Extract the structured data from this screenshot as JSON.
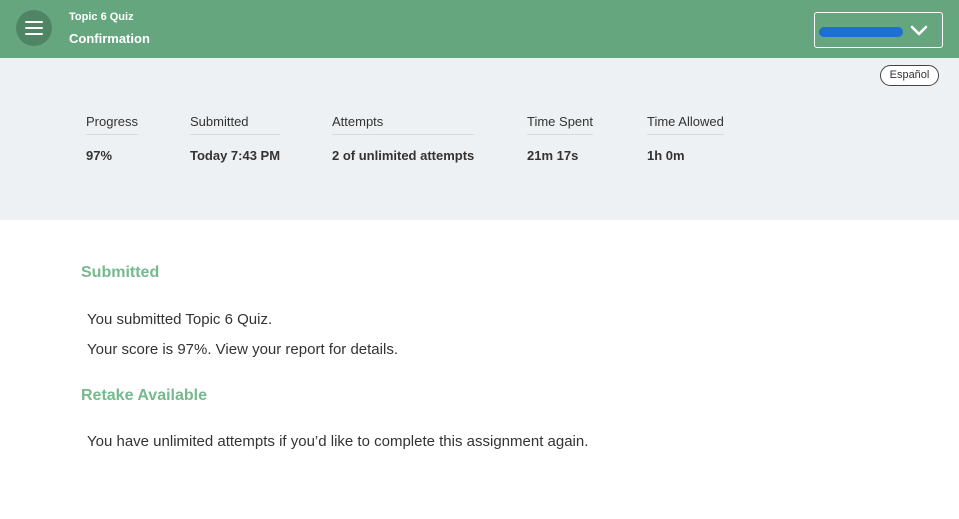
{
  "header": {
    "subtitle": "Topic 6 Quiz",
    "title": "Confirmation",
    "accent_color": "#66a67f",
    "menu_icon": "hamburger-icon",
    "dropdown_icon": "chevron-down-icon"
  },
  "language_button": "Español",
  "stats": [
    {
      "label": "Progress",
      "value": "97%"
    },
    {
      "label": "Submitted",
      "value": "Today 7:43 PM"
    },
    {
      "label": "Attempts",
      "value": "2 of unlimited attempts"
    },
    {
      "label": "Time Spent",
      "value": "21m 17s"
    },
    {
      "label": "Time Allowed",
      "value": "1h 0m"
    }
  ],
  "submitted_section": {
    "heading": "Submitted",
    "line1": "You submitted Topic 6 Quiz.",
    "line2": "Your score is 97%. View your report for details."
  },
  "retake_section": {
    "heading": "Retake Available",
    "line1": "You have unlimited attempts if you’d like to complete this assignment again."
  },
  "heading_color": "#77b98f"
}
